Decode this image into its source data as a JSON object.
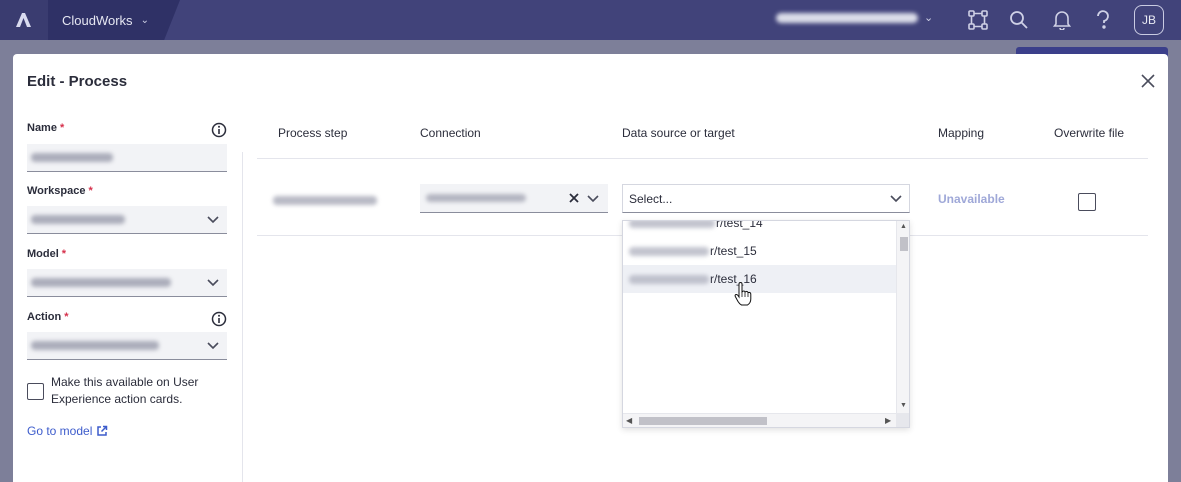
{
  "topbar": {
    "workspace_label": "CloudWorks",
    "avatar_initials": "JB",
    "icons": [
      "anaplan-logo-icon",
      "chevron-down-icon",
      "integrations-icon",
      "search-icon",
      "bell-icon",
      "help-icon"
    ]
  },
  "modal": {
    "title": "Edit - Process",
    "close_icon": "close-icon"
  },
  "form": {
    "name_label": "Name",
    "workspace_label": "Workspace",
    "model_label": "Model",
    "action_label": "Action",
    "required_mark": "*",
    "checkbox_text": "Make this available on User Experience action cards.",
    "goto_model": "Go to model"
  },
  "grid": {
    "headers": {
      "step": "Process step",
      "connection": "Connection",
      "source": "Data source or target",
      "mapping": "Mapping",
      "overwrite": "Overwrite file"
    },
    "row": {
      "source_placeholder": "Select...",
      "mapping_status": "Unavailable"
    }
  },
  "dropdown": {
    "options": [
      "r/test_14",
      "r/test_15",
      "r/test_16"
    ],
    "hovered_option": "r/test_16"
  },
  "colors": {
    "topbar": "#41437a",
    "link": "#3d5ccc",
    "required": "#d6304b",
    "mapping_unavailable": "#9fa8d8"
  }
}
